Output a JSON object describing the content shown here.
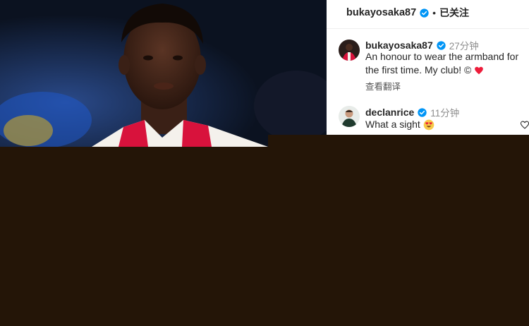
{
  "post": {
    "author": "bukayosaka87",
    "separator": "•",
    "follow_label": "已关注"
  },
  "comments": [
    {
      "user": "bukayosaka87",
      "time": "27分钟",
      "text_line1": "An honour to wear the armband for",
      "text_line2": "the first time. My club! ©",
      "translate_label": "查看翻译"
    },
    {
      "user": "declanrice",
      "time": "11分钟",
      "text": "What a sight"
    }
  ],
  "colors": {
    "verified_blue": "#0095f6",
    "heart_red": "#ed1c3a",
    "background_brown": "#241507"
  }
}
